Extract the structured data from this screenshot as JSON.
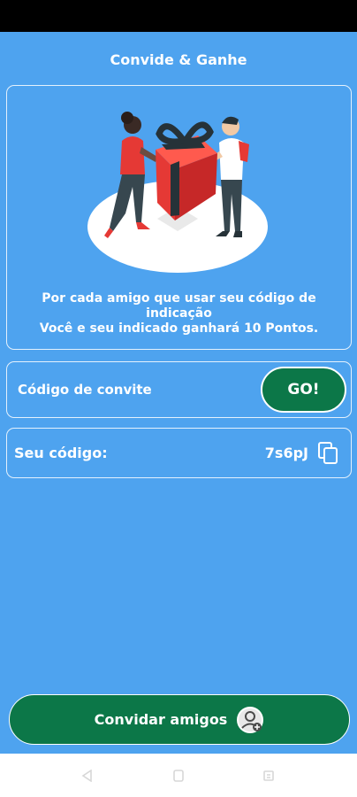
{
  "header": {
    "title": "Convide & Ganhe"
  },
  "hero": {
    "line1": "Por cada amigo que usar seu código de",
    "line2": "indicação",
    "line3": "Você e seu indicado ganhará 10 Pontos."
  },
  "invite": {
    "label": "Código de convite",
    "go_label": "GO!"
  },
  "my_code": {
    "label": "Seu código:",
    "value": "7s6pJ",
    "icon": "copy-icon"
  },
  "footer": {
    "invite_friends_label": "Convidar amigos",
    "icon": "user-add-icon"
  },
  "colors": {
    "background": "#4ea3ef",
    "button_green": "#0c7748",
    "gift_red": "#e53935"
  },
  "navigation": {
    "icons": [
      "back-icon",
      "home-icon",
      "recents-icon"
    ]
  }
}
